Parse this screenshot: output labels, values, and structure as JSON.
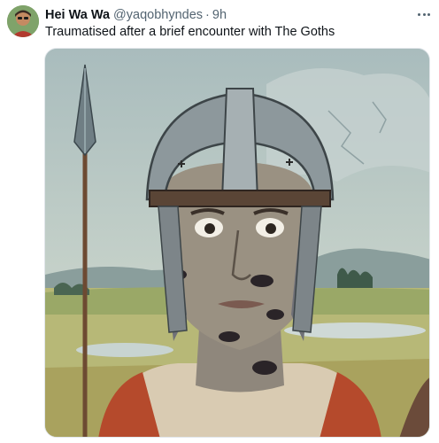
{
  "tweet": {
    "author": {
      "display_name": "Hei Wa Wa",
      "handle": "@yaqobhyndes",
      "separator": "·",
      "time": "9h",
      "avatar_icon": "user-avatar"
    },
    "text": "Traumatised after a brief encounter with The Goths",
    "more_icon": "more-horizontal-icon",
    "media": {
      "type": "illustration",
      "subject": "soldier-with-helmet-and-spear"
    }
  },
  "colors": {
    "text_primary": "#0f1419",
    "text_secondary": "#536471",
    "border": "#e1e6ea"
  }
}
